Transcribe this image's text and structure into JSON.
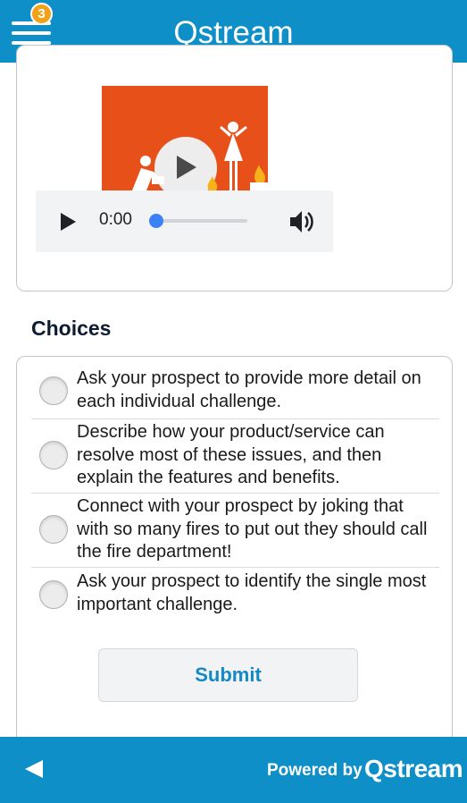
{
  "header": {
    "title": "Qstream",
    "notification_count": "3"
  },
  "media": {
    "time": "0:00",
    "progress": 0
  },
  "choices": {
    "heading": "Choices",
    "options": [
      {
        "label": "Ask your prospect to provide more detail on each individual challenge."
      },
      {
        "label": "Describe how your product/service can resolve most of these issues, and then explain the features and benefits."
      },
      {
        "label": "Connect with your prospect by joking that with so many fires to put out they should call the fire department!"
      },
      {
        "label": "Ask your prospect to identify the single most important challenge."
      }
    ],
    "submit_label": "Submit"
  },
  "footer": {
    "powered_by": "Powered by",
    "logo_text": "Qstream"
  },
  "colors": {
    "brand_blue": "#0f8fc7",
    "badge_orange": "#f0a31a",
    "thumbnail_orange": "#e8501a",
    "submit_text": "#1689c2"
  }
}
